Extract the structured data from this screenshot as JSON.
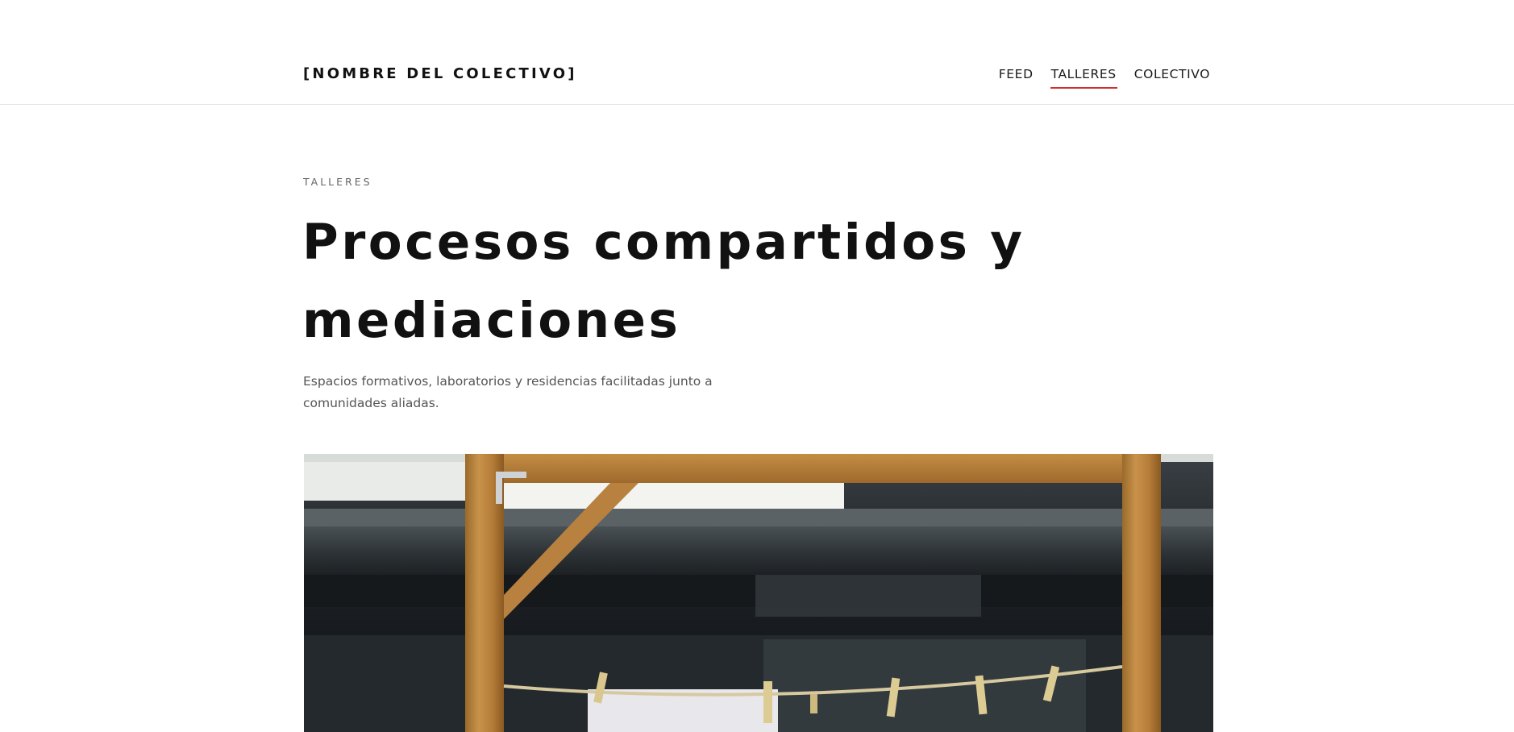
{
  "header": {
    "brand": "[NOMBRE DEL COLECTIVO]",
    "nav": [
      {
        "label": "FEED",
        "active": false
      },
      {
        "label": "TALLERES",
        "active": true
      },
      {
        "label": "COLECTIVO",
        "active": false
      }
    ]
  },
  "hero": {
    "eyebrow": "TALLERES",
    "title": "Procesos compartidos y mediaciones",
    "lead": "Espacios formativos, laboratorios y residencias facilitadas junto a comunidades aliadas."
  },
  "colors": {
    "accent": "#d32f2f",
    "text": "#111111",
    "muted": "#555555",
    "divider": "#e3e3e3"
  }
}
